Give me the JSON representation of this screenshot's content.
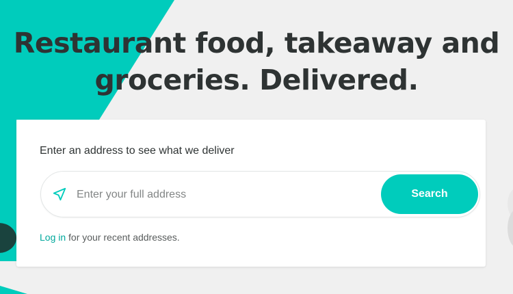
{
  "headline": {
    "line1": "Restaurant food, takeaway and",
    "line2": "groceries. Delivered."
  },
  "address_card": {
    "label": "Enter an address to see what we deliver",
    "input_placeholder": "Enter your full address",
    "input_value": "",
    "search_button": "Search",
    "login_link": "Log in",
    "login_suffix": " for your recent addresses."
  },
  "colors": {
    "brand_teal": "#00ccbc",
    "link_teal": "#00a89c",
    "background": "#f0f0f0",
    "text_dark": "#2e3333"
  },
  "icons": {
    "location": "navigation-arrow-icon"
  }
}
